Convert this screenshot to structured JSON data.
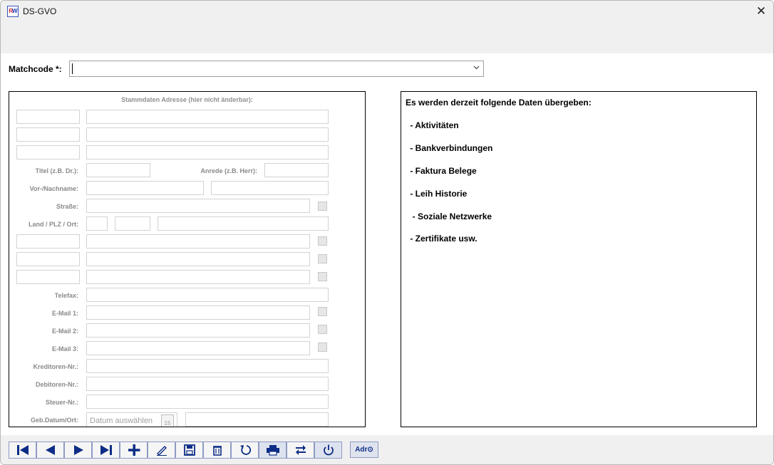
{
  "window": {
    "title": "DS-GVO",
    "icon": "rw-app-icon",
    "close_glyph": "✕"
  },
  "matchcode": {
    "label": "Matchcode *:",
    "value": ""
  },
  "stammdaten": {
    "heading": "Stammdaten Adresse (hier nicht änderbar):",
    "labels": {
      "titel": "Titel (z.B. Dr.):",
      "anrede": "Anrede (z.B. Herr):",
      "vor_nachname": "Vor-/Nachname:",
      "strasse": "Straße:",
      "land_plz_ort": "Land / PLZ / Ort:",
      "telefax": "Telefax:",
      "email1": "E-Mail 1:",
      "email2": "E-Mail 2:",
      "email3": "E-Mail 3:",
      "kreditoren": "Kreditoren-Nr.:",
      "debitoren": "Debitoren-Nr.:",
      "steuer": "Steuer-Nr.:",
      "geb_datum": "Geb.Datum/Ort:"
    },
    "date_placeholder": "Datum auswählen",
    "calendar_day": "15"
  },
  "info": {
    "heading": "Es werden derzeit folgende Daten übergeben:",
    "items": [
      " - Aktivitäten",
      " - Bankverbindungen",
      " - Faktura Belege",
      " - Leih Historie",
      "  - Soziale Netzwerke",
      " - Zertifikate usw."
    ]
  },
  "toolbar": {
    "buttons": [
      {
        "name": "first-record-button",
        "icon": "first-icon"
      },
      {
        "name": "previous-record-button",
        "icon": "previous-icon"
      },
      {
        "name": "next-record-button",
        "icon": "next-icon"
      },
      {
        "name": "last-record-button",
        "icon": "last-icon"
      },
      {
        "name": "add-button",
        "icon": "plus-icon"
      },
      {
        "name": "edit-button",
        "icon": "pencil-icon"
      },
      {
        "name": "save-button",
        "icon": "floppy-disk-icon"
      },
      {
        "name": "delete-button",
        "icon": "trash-icon"
      },
      {
        "name": "refresh-button",
        "icon": "refresh-icon"
      },
      {
        "name": "print-button",
        "icon": "printer-icon"
      },
      {
        "name": "swap-button",
        "icon": "swap-arrows-icon"
      },
      {
        "name": "exit-button",
        "icon": "power-icon"
      }
    ],
    "adr_label": "Adr⊙"
  },
  "colors": {
    "titlebar_bg": "#f0f0f0",
    "toolbar_icon": "#0c2c86",
    "label_gray": "#8a8a8a"
  }
}
